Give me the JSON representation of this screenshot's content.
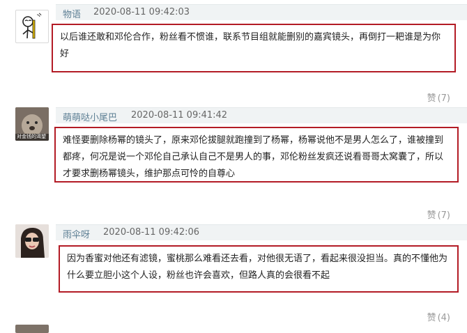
{
  "comments": [
    {
      "username": "物语",
      "time": "2020-08-11 09:42:03",
      "text": "以后谁还敢和邓伦合作，粉丝看不惯谁，联系节目组就能删别的嘉宾镜头，再倒打一耙谁是为你好",
      "like_label": "赞",
      "like_count": "(7)"
    },
    {
      "username": "萌萌哒小尾巴",
      "avatar_caption": "对金钱的渴望",
      "time": "2020-08-11 09:41:42",
      "text": "难怪要删除杨幂的镜头了，原来邓伦拔腿就跑撞到了杨幂，杨幂说他不是男人怎么了，谁被撞到都疼，何况是说一个邓伦自己承认自己不是男人的事，邓伦粉丝发疯还说看哥哥太窝囊了，所以才要求删杨幂镜头，维护那点可怜的自尊心",
      "like_label": "赞",
      "like_count": "(7)"
    },
    {
      "username": "雨伞呀",
      "time": "2020-08-11 09:42:06",
      "text": "因为香蜜对他还有滤镜，蜜桃那么难看还去看，对他很无语了，看起来很没担当。真的不懂他为什么要立胆小这个人设，粉丝也许会喜欢，但路人真的会很看不起",
      "like_label": "赞",
      "like_count": "(4)"
    }
  ]
}
